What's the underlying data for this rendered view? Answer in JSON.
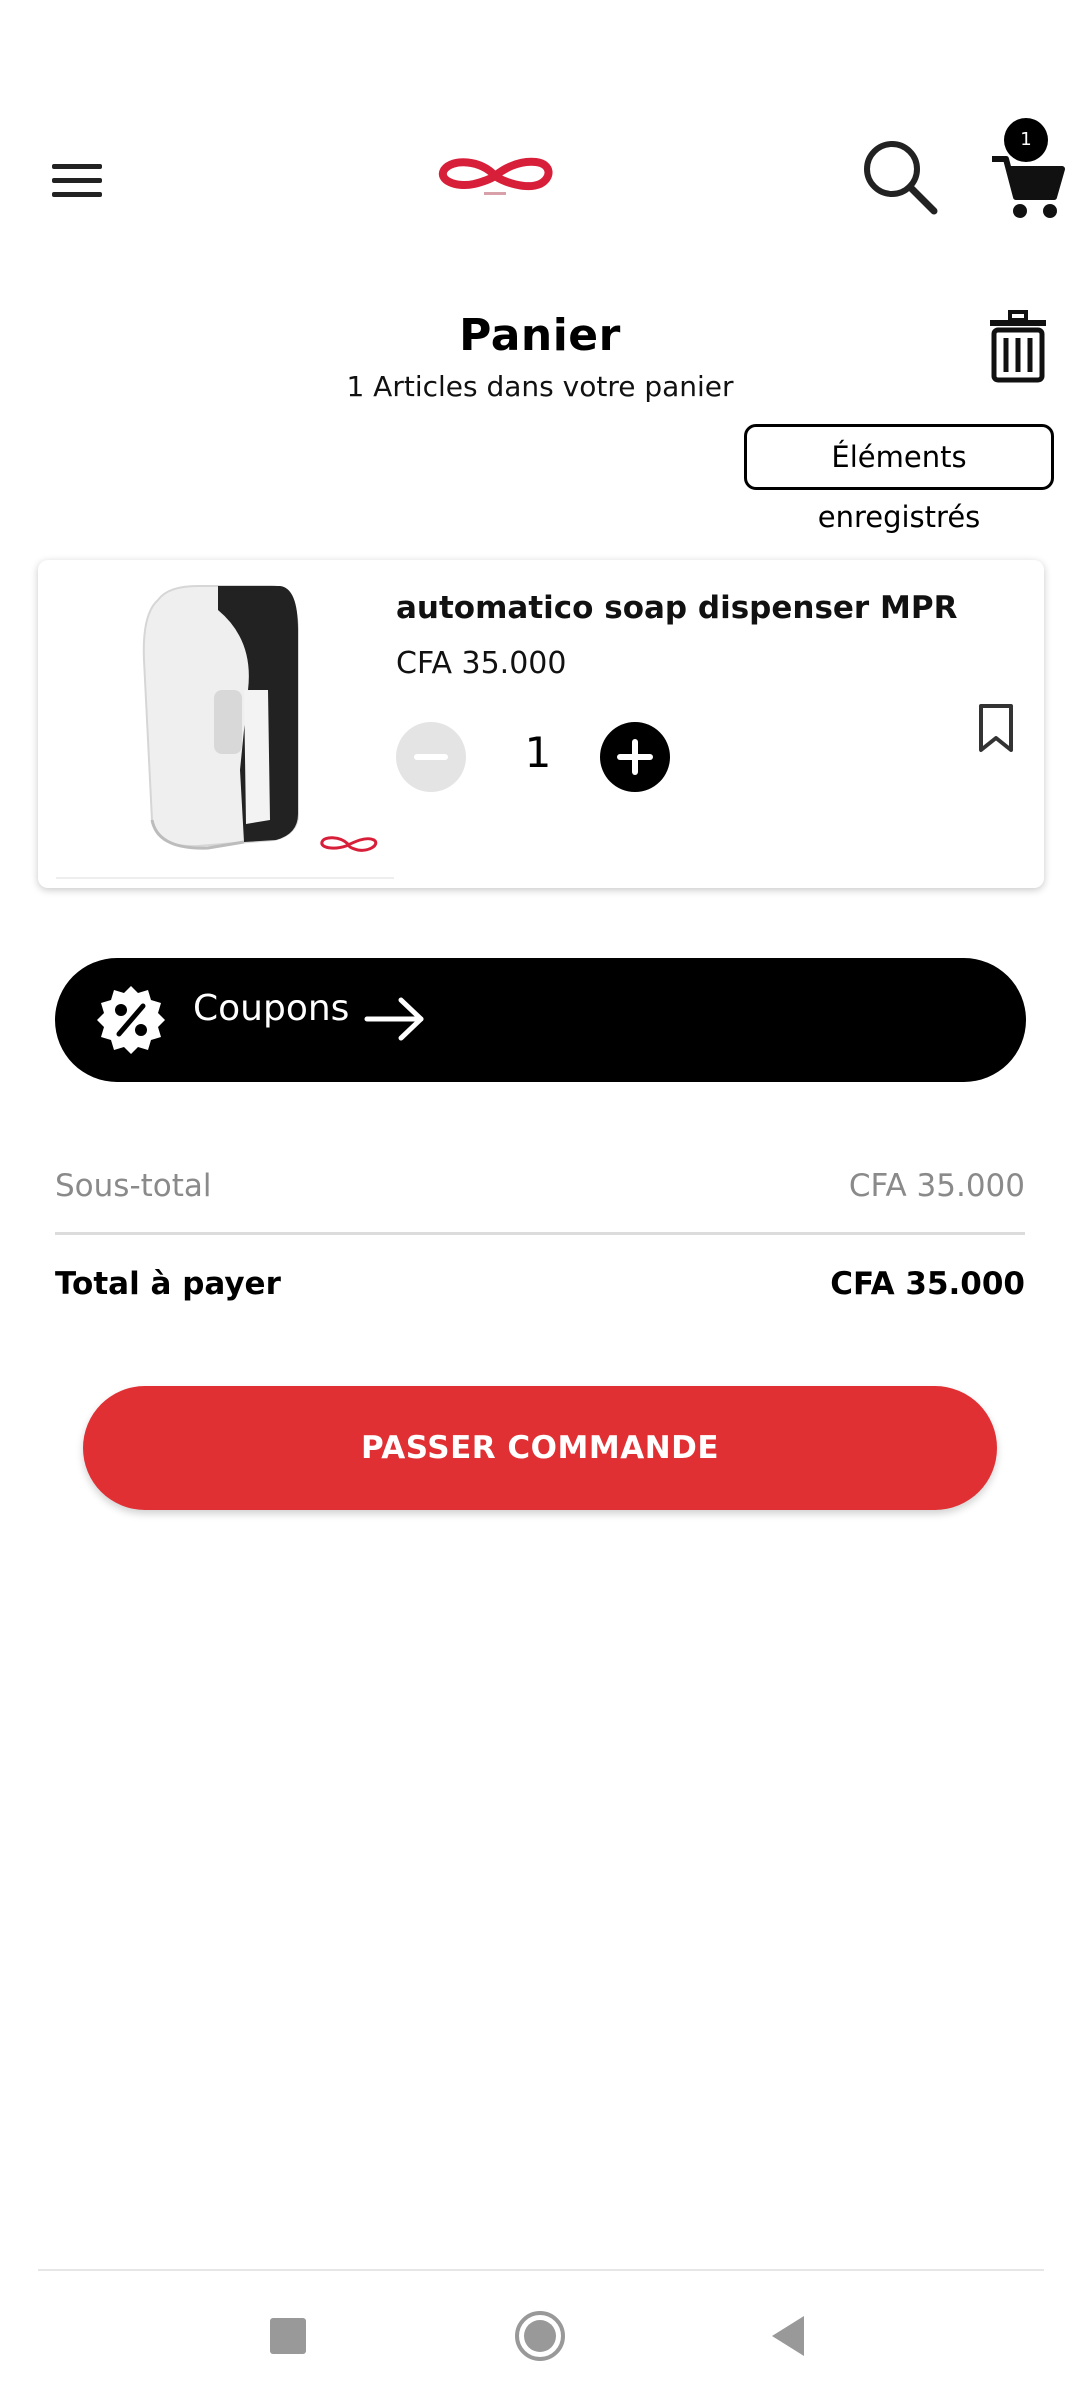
{
  "header": {
    "menu_icon": "hamburger-menu-icon",
    "logo_icon": "brand-infinity-logo",
    "search_icon": "search-icon",
    "cart_icon": "shopping-cart-icon",
    "cart_count": "1"
  },
  "cart": {
    "title": "Panier",
    "subtitle": "1 Articles dans votre panier",
    "trash_icon": "trash-icon",
    "saved_items_label": "Éléments enregistrés"
  },
  "items": [
    {
      "name": "automatico soap dispenser MPR",
      "price": "CFA 35.000",
      "quantity": "1",
      "image_icon": "soap-dispenser-image",
      "bookmark_icon": "bookmark-icon"
    }
  ],
  "coupons": {
    "label": "Coupons",
    "icon": "percent-badge-icon",
    "arrow_icon": "arrow-right-icon"
  },
  "summary": {
    "subtotal_label": "Sous-total",
    "subtotal_value": "CFA 35.000",
    "total_label": "Total à payer",
    "total_value": "CFA 35.000"
  },
  "checkout": {
    "label": "PASSER COMMANDE"
  },
  "nav": {
    "recents_icon": "square-recents-icon",
    "home_icon": "circle-home-icon",
    "back_icon": "triangle-back-icon"
  },
  "colors": {
    "accent": "#e03034",
    "brand_logo": "#d81f3a",
    "coupon_bg": "#000000"
  }
}
